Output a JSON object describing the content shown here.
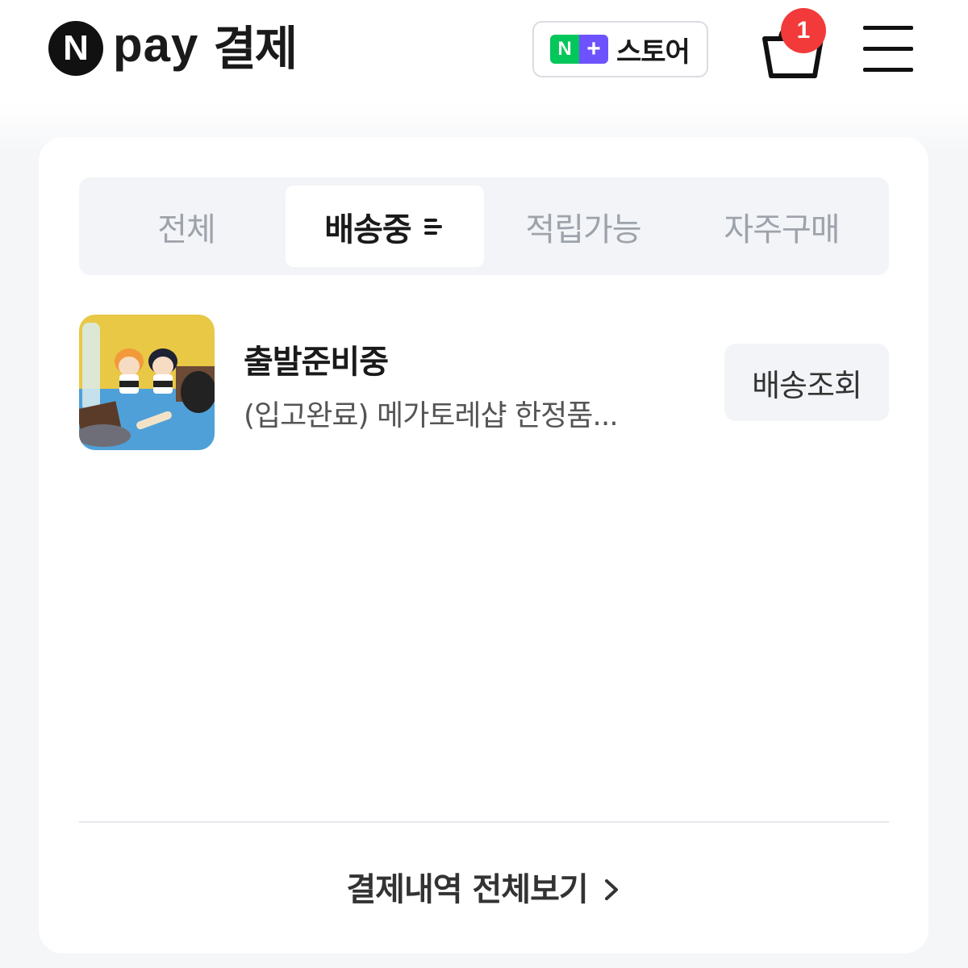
{
  "header": {
    "logo_letter": "N",
    "logo_pay": "pay",
    "title": "결제",
    "store_button": {
      "n_glyph": "N",
      "plus_glyph": "+",
      "label": "스토어",
      "n_color": "#03c75a",
      "plus_color": "#6d52ff"
    },
    "cart": {
      "icon": "shopping-bag-icon",
      "badge_count": "1",
      "badge_color": "#f23a3a"
    },
    "menu_icon": "hamburger-menu-icon"
  },
  "tabs": [
    {
      "label": "전체",
      "active": false
    },
    {
      "label": "배송중",
      "active": true,
      "icon": "filter-icon"
    },
    {
      "label": "적립가능",
      "active": false
    },
    {
      "label": "자주구매",
      "active": false
    }
  ],
  "order": {
    "status": "출발준비중",
    "product_name": "(입고완료) 메가토레샵 한정품...",
    "track_button": "배송조회"
  },
  "footer": {
    "view_all_label": "결제내역 전체보기",
    "view_all_icon": "chevron-right-icon"
  }
}
